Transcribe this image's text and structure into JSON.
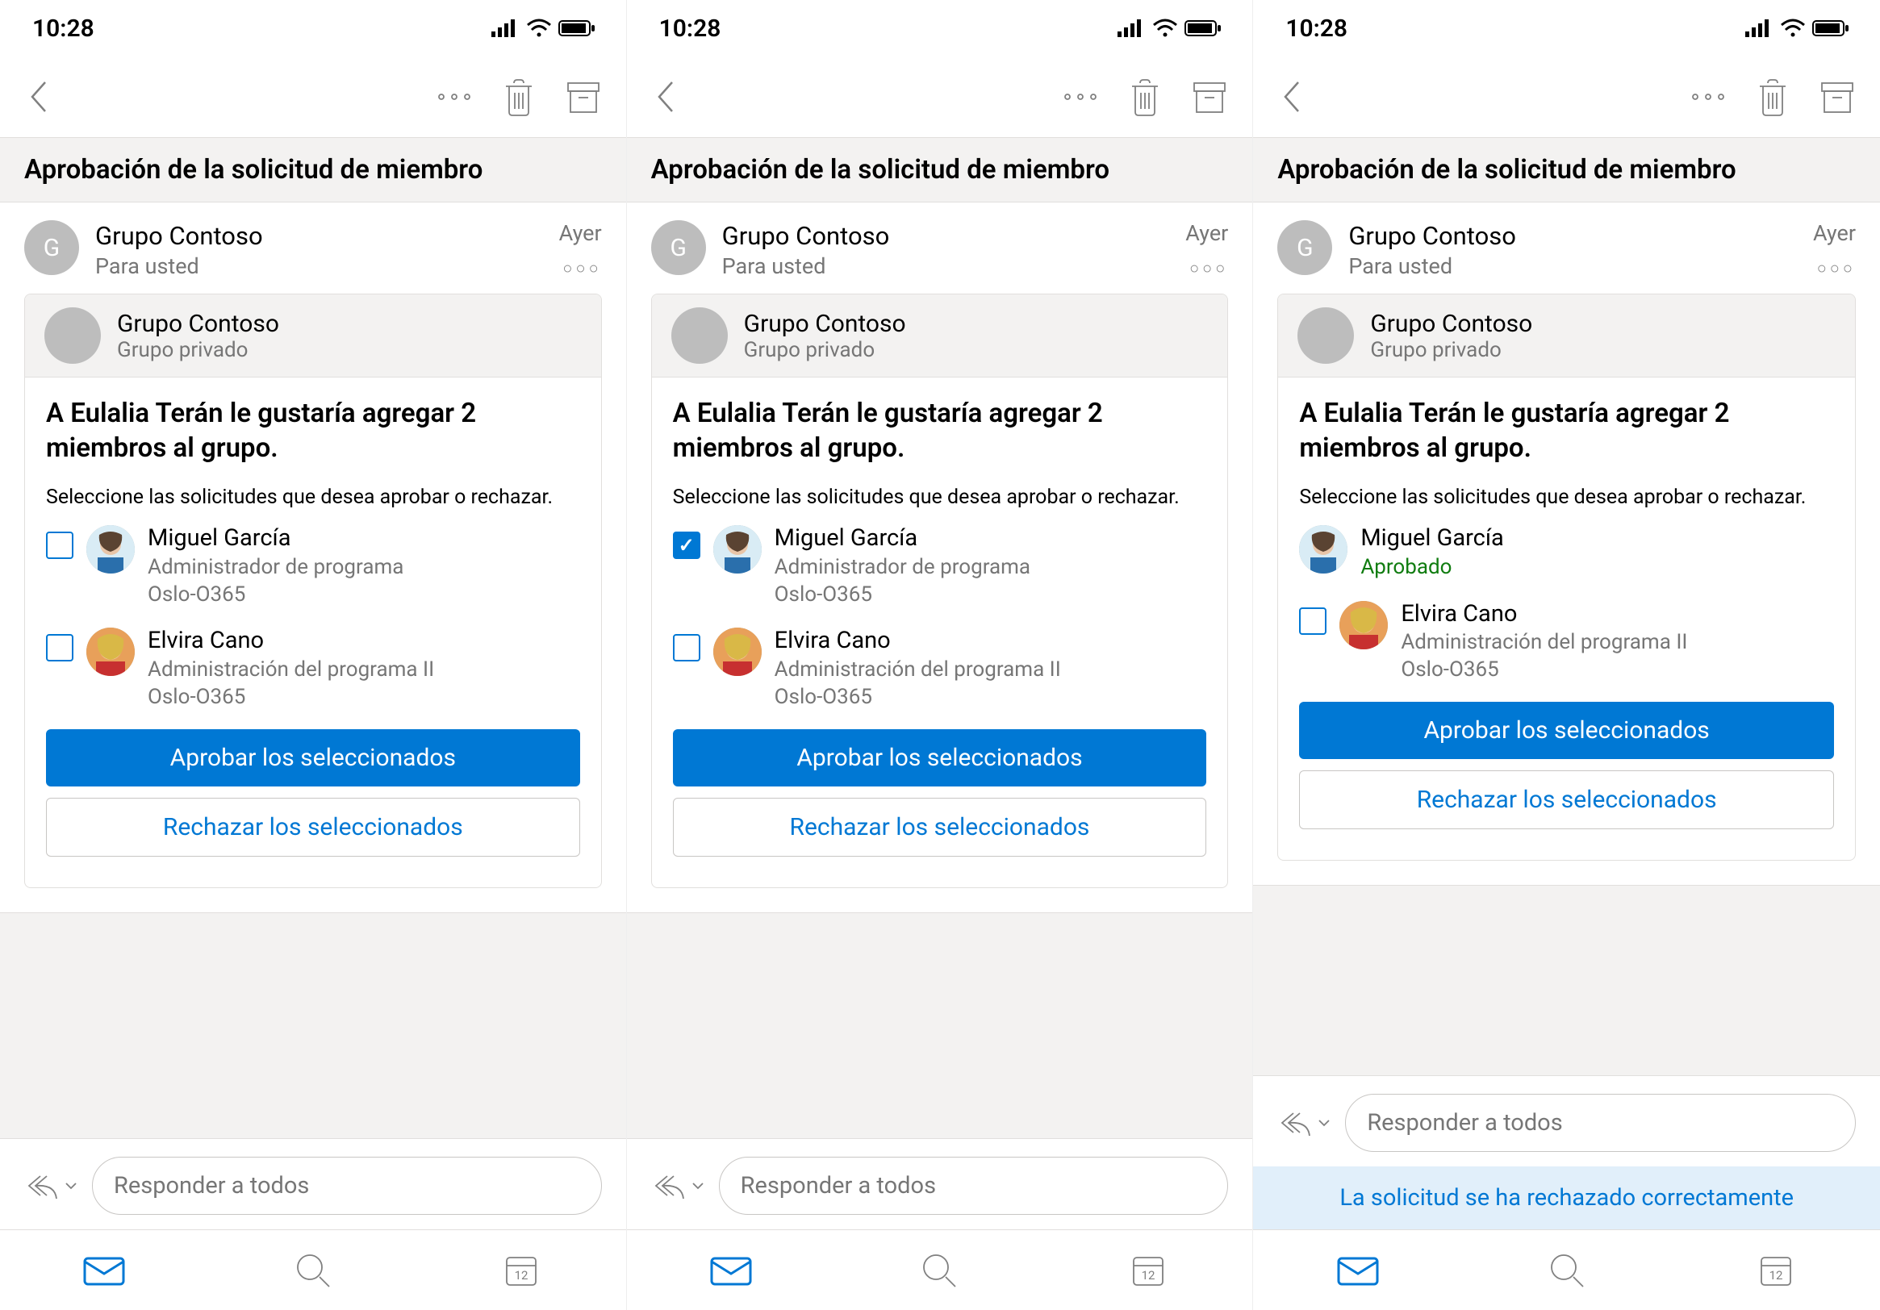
{
  "status": {
    "time": "10:28"
  },
  "subject": "Aprobación de la solicitud de miembro",
  "sender": {
    "avatar_initial": "G",
    "name": "Grupo Contoso",
    "to": "Para usted",
    "date": "Ayer"
  },
  "group": {
    "name": "Grupo Contoso",
    "privacy": "Grupo privado"
  },
  "message": {
    "title": "A Eulalia Terán le gustaría agregar 2 miembros al grupo.",
    "instruction": "Seleccione las solicitudes que desea aprobar o rechazar."
  },
  "buttons": {
    "approve": "Aprobar los seleccionados",
    "reject": "Rechazar los seleccionados"
  },
  "reply_placeholder": "Responder a todos",
  "toast": "La solicitud se ha rechazado correctamente",
  "members": {
    "miguel": {
      "name": "Miguel García",
      "role": "Administrador de programa",
      "loc": "Oslo-O365"
    },
    "elvira": {
      "name": "Elvira Cano",
      "role": "Administración del programa II",
      "loc": "Oslo-O365"
    }
  },
  "status_approved": "Aprobado"
}
